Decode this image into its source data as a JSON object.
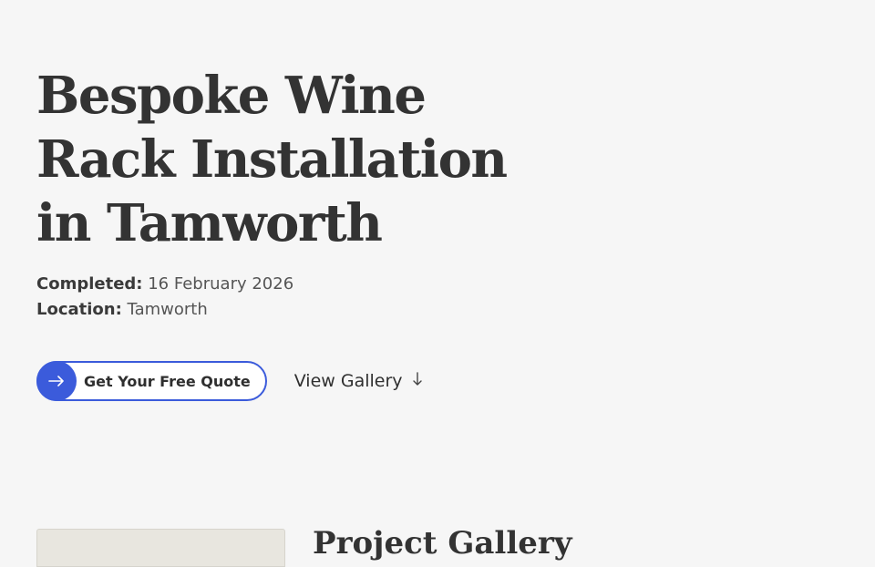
{
  "hero": {
    "title": "Bespoke Wine Rack Installation in Tamworth"
  },
  "meta": {
    "completed_label": "Completed:",
    "completed_value": "16 February 2026",
    "location_label": "Location:",
    "location_value": "Tamworth"
  },
  "actions": {
    "quote_label": "Get Your Free Quote",
    "quote_icon": "arrow-right-icon",
    "gallery_label": "View Gallery",
    "gallery_icon": "arrow-down-icon"
  },
  "gallery": {
    "title": "Project Gallery"
  },
  "colors": {
    "accent": "#3b5bdb",
    "background": "#f6f6f6",
    "text": "#333333"
  }
}
